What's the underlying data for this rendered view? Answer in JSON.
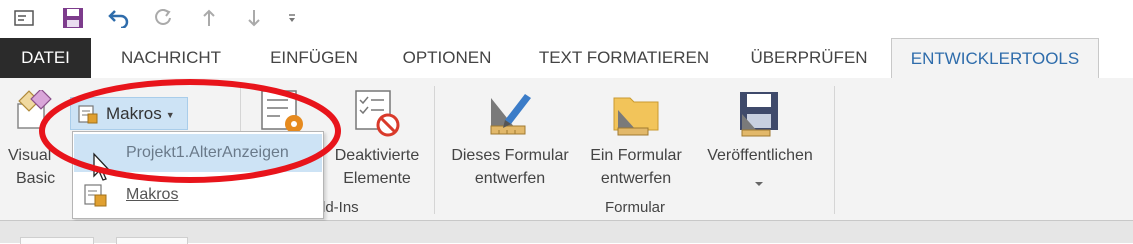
{
  "quick_access": {
    "icons": [
      "new-message-icon",
      "save-icon",
      "undo-icon",
      "redo-icon",
      "arrow-up-icon",
      "arrow-down-icon",
      "customize-toolbar-icon"
    ]
  },
  "tabs": [
    {
      "label": "DATEI",
      "state": "file"
    },
    {
      "label": "NACHRICHT"
    },
    {
      "label": "EINFÜGEN"
    },
    {
      "label": "OPTIONEN"
    },
    {
      "label": "TEXT FORMATIEREN"
    },
    {
      "label": "ÜBERPRÜFEN"
    },
    {
      "label": "ENTWICKLERTOOLS",
      "state": "active"
    }
  ],
  "ribbon": {
    "visual_basic": {
      "line1": "Visual",
      "line2": "Basic"
    },
    "makros_button": {
      "label": "Makros"
    },
    "addins_group_label": "ld-Ins",
    "deaktivierte": {
      "line1": "Deaktivierte",
      "line2": "Elemente"
    },
    "dieses_formular": {
      "line1": "Dieses Formular",
      "line2": "entwerfen"
    },
    "ein_formular": {
      "line1": "Ein Formular",
      "line2": "entwerfen"
    },
    "veroeffentlichen": {
      "line1": "Veröffentlichen"
    },
    "formular_group_label": "Formular"
  },
  "dropdown": {
    "items": [
      {
        "label": "Projekt1.AlterAnzeigen",
        "highlighted": true
      },
      {
        "label": "Makros"
      }
    ]
  },
  "colors": {
    "accent": "#2e6cab",
    "file_tab": "#2b2b2b",
    "highlight": "#cde3f5",
    "annotation": "#e8141b"
  }
}
